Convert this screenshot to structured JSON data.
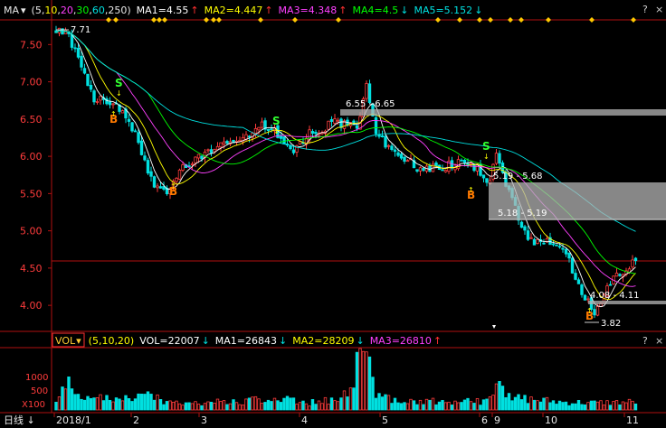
{
  "main_header": {
    "indicator": "MA",
    "dropdown_glyph": "▾",
    "params_open": "(",
    "params_close": ")",
    "params": [
      {
        "text": "5",
        "color": "#e8e8e8"
      },
      {
        "text": ",",
        "color": "#e8e8e8"
      },
      {
        "text": "10",
        "color": "#ffff00"
      },
      {
        "text": ",",
        "color": "#e8e8e8"
      },
      {
        "text": "20",
        "color": "#ff40ff"
      },
      {
        "text": ",",
        "color": "#e8e8e8"
      },
      {
        "text": "30",
        "color": "#00ff00"
      },
      {
        "text": ",",
        "color": "#e8e8e8"
      },
      {
        "text": "60",
        "color": "#00e0e0"
      },
      {
        "text": ",",
        "color": "#e8e8e8"
      },
      {
        "text": "250",
        "color": "#e8e8e8"
      }
    ],
    "values": [
      {
        "label": "MA1=4.55",
        "arrow": "↑",
        "color": "#ffffff",
        "arrow_color": "#ff3030"
      },
      {
        "label": "MA2=4.447",
        "arrow": "↑",
        "color": "#ffff00",
        "arrow_color": "#ff3030"
      },
      {
        "label": "MA3=4.348",
        "arrow": "↑",
        "color": "#ff40ff",
        "arrow_color": "#ff3030"
      },
      {
        "label": "MA4=4.5",
        "arrow": "↓",
        "color": "#00ff00",
        "arrow_color": "#00e0e0"
      },
      {
        "label": "MA5=5.152",
        "arrow": "↓",
        "color": "#00e0e0",
        "arrow_color": "#00e0e0"
      }
    ],
    "controls": [
      "?",
      "×"
    ]
  },
  "vol_header": {
    "indicator": "VOL",
    "dropdown_glyph": "▾",
    "params": "(5,10,20)",
    "values": [
      {
        "label": "VOL=22007",
        "arrow": "↓",
        "color": "#ffffff",
        "arrow_color": "#00e0e0"
      },
      {
        "label": "MA1=26843",
        "arrow": "↓",
        "color": "#ffffff",
        "arrow_color": "#00e0e0"
      },
      {
        "label": "MA2=28209",
        "arrow": "↓",
        "color": "#ffff00",
        "arrow_color": "#00e0e0"
      },
      {
        "label": "MA3=26810",
        "arrow": "↑",
        "color": "#ff40ff",
        "arrow_color": "#ff3030"
      }
    ],
    "controls": [
      "?",
      "×"
    ],
    "axis_labels": [
      "1000",
      "500"
    ],
    "unit": "X100"
  },
  "bottom_bar": {
    "period": "日线",
    "period_arrow": "↓",
    "dates": [
      "2018/1",
      "2",
      "3",
      "4",
      "5",
      "6",
      "9",
      "10",
      "11"
    ]
  },
  "y_axis_labels": [
    "7.50",
    "7.00",
    "6.50",
    "6.00",
    "5.50",
    "5.00",
    "4.50",
    "4.00"
  ],
  "annotations": [
    {
      "text": "7.71"
    },
    {
      "text": "6.55 - 6.65"
    },
    {
      "text": "5.19 - 5.68"
    },
    {
      "text": "5.18 - 5.19"
    },
    {
      "text": "4.08 - 4.11"
    },
    {
      "text": "3.82"
    }
  ],
  "signals": {
    "buy": "B",
    "sell": "S"
  },
  "colors": {
    "up": "#ff3c3c",
    "down": "#00e0e0",
    "axis": "#b01010",
    "ma5": "#ffffff",
    "ma10": "#ffff00",
    "ma20": "#ff40ff",
    "ma30": "#00ff00",
    "ma60": "#00e0e0",
    "event": "#ffc800"
  },
  "chart_data": {
    "type": "candlestick",
    "x_axis": [
      "2018/1",
      "2",
      "3",
      "4",
      "5",
      "6",
      "9",
      "10",
      "11"
    ],
    "ylim": [
      3.82,
      7.71
    ],
    "y_ticks": [
      7.5,
      7.0,
      6.5,
      6.0,
      5.5,
      5.0,
      4.5,
      4.0
    ],
    "price_points": [
      [
        0,
        7.71
      ],
      [
        4,
        7.62
      ],
      [
        8,
        7.2
      ],
      [
        12,
        6.75
      ],
      [
        16,
        6.75
      ],
      [
        20,
        6.65
      ],
      [
        25,
        6.3
      ],
      [
        28,
        5.9
      ],
      [
        31,
        5.6
      ],
      [
        35,
        5.55
      ],
      [
        40,
        5.85
      ],
      [
        45,
        6.0
      ],
      [
        52,
        6.15
      ],
      [
        60,
        6.25
      ],
      [
        65,
        6.45
      ],
      [
        70,
        6.3
      ],
      [
        74,
        6.05
      ],
      [
        80,
        6.3
      ],
      [
        88,
        6.45
      ],
      [
        95,
        6.4
      ],
      [
        98,
        6.95
      ],
      [
        101,
        6.3
      ],
      [
        107,
        6.05
      ],
      [
        114,
        5.85
      ],
      [
        120,
        5.85
      ],
      [
        127,
        5.9
      ],
      [
        133,
        5.85
      ],
      [
        136,
        5.6
      ],
      [
        139,
        6.0
      ],
      [
        141,
        5.75
      ],
      [
        145,
        5.3
      ],
      [
        149,
        4.85
      ],
      [
        155,
        4.85
      ],
      [
        160,
        4.8
      ],
      [
        165,
        4.25
      ],
      [
        170,
        3.9
      ],
      [
        175,
        4.3
      ],
      [
        180,
        4.5
      ],
      [
        183,
        4.6
      ]
    ],
    "moving_averages": [
      {
        "name": "MA1",
        "period": 5,
        "last": 4.55
      },
      {
        "name": "MA2",
        "period": 10,
        "last": 4.447
      },
      {
        "name": "MA3",
        "period": 20,
        "last": 4.348
      },
      {
        "name": "MA4",
        "period": 30,
        "last": 4.5
      },
      {
        "name": "MA5",
        "period": 60,
        "last": 5.152
      }
    ],
    "price_bands": [
      [
        6.55,
        6.65
      ],
      [
        5.19,
        5.68
      ],
      [
        5.18,
        5.19
      ],
      [
        4.08,
        4.11
      ]
    ],
    "volume": {
      "last": 22007,
      "ma": [
        {
          "name": "MA1",
          "period": 5,
          "last": 26843
        },
        {
          "name": "MA2",
          "period": 10,
          "last": 28209
        },
        {
          "name": "MA3",
          "period": 20,
          "last": 26810
        }
      ],
      "points": [
        [
          0,
          300
        ],
        [
          3,
          900
        ],
        [
          6,
          500
        ],
        [
          12,
          350
        ],
        [
          20,
          250
        ],
        [
          28,
          450
        ],
        [
          35,
          200
        ],
        [
          45,
          200
        ],
        [
          60,
          250
        ],
        [
          70,
          300
        ],
        [
          80,
          200
        ],
        [
          90,
          300
        ],
        [
          98,
          1800
        ],
        [
          100,
          700
        ],
        [
          101,
          500
        ],
        [
          108,
          280
        ],
        [
          115,
          250
        ],
        [
          125,
          220
        ],
        [
          135,
          250
        ],
        [
          139,
          700
        ],
        [
          143,
          350
        ],
        [
          150,
          300
        ],
        [
          160,
          220
        ],
        [
          170,
          200
        ],
        [
          183,
          230
        ]
      ]
    }
  }
}
